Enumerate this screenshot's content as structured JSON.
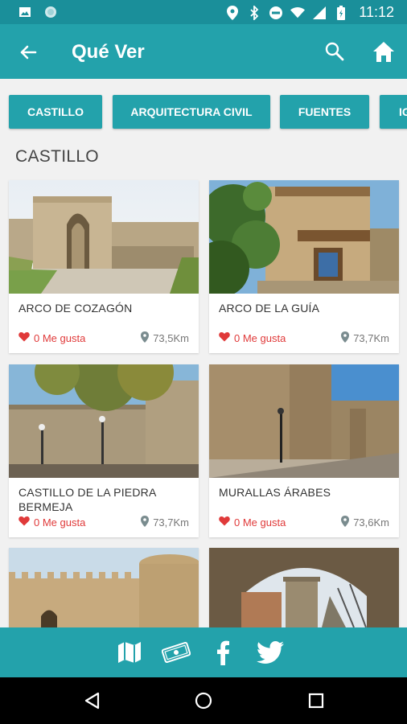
{
  "status_bar": {
    "time": "11:12",
    "icons": [
      "image-icon",
      "circle-icon",
      "location-icon",
      "bluetooth-icon",
      "do-not-disturb-icon",
      "wifi-icon",
      "signal-icon",
      "battery-icon"
    ]
  },
  "app_bar": {
    "title": "Qué Ver",
    "back_icon": "arrow-left-icon",
    "search_icon": "search-icon",
    "home_icon": "home-icon"
  },
  "categories": [
    {
      "label": "CASTILLO"
    },
    {
      "label": "ARQUITECTURA CIVIL"
    },
    {
      "label": "FUENTES"
    },
    {
      "label": "IG"
    }
  ],
  "section_title": "CASTILLO",
  "places": [
    {
      "name": "ARCO DE COZAGÓN",
      "likes": "0 Me gusta",
      "distance": "73,5Km"
    },
    {
      "name": "ARCO DE LA GUÍA",
      "likes": "0 Me gusta",
      "distance": "73,7Km"
    },
    {
      "name": "CASTILLO DE LA PIEDRA BERMEJA",
      "likes": "0 Me gusta",
      "distance": "73,7Km"
    },
    {
      "name": "MURALLAS ÁRABES",
      "likes": "0 Me gusta",
      "distance": "73,6Km"
    },
    {
      "name": "",
      "likes": "",
      "distance": ""
    },
    {
      "name": "",
      "likes": "",
      "distance": ""
    }
  ],
  "bottom_bar": {
    "buttons": [
      "map-icon",
      "money-icon",
      "facebook-icon",
      "twitter-icon"
    ]
  },
  "nav_bar": {
    "buttons": [
      "back-triangle-icon",
      "home-circle-icon",
      "recents-square-icon"
    ]
  },
  "colors": {
    "status_bar": "#1a8f9a",
    "primary": "#23a2ab",
    "like": "#e03a3a",
    "background": "#f1f1f1"
  }
}
